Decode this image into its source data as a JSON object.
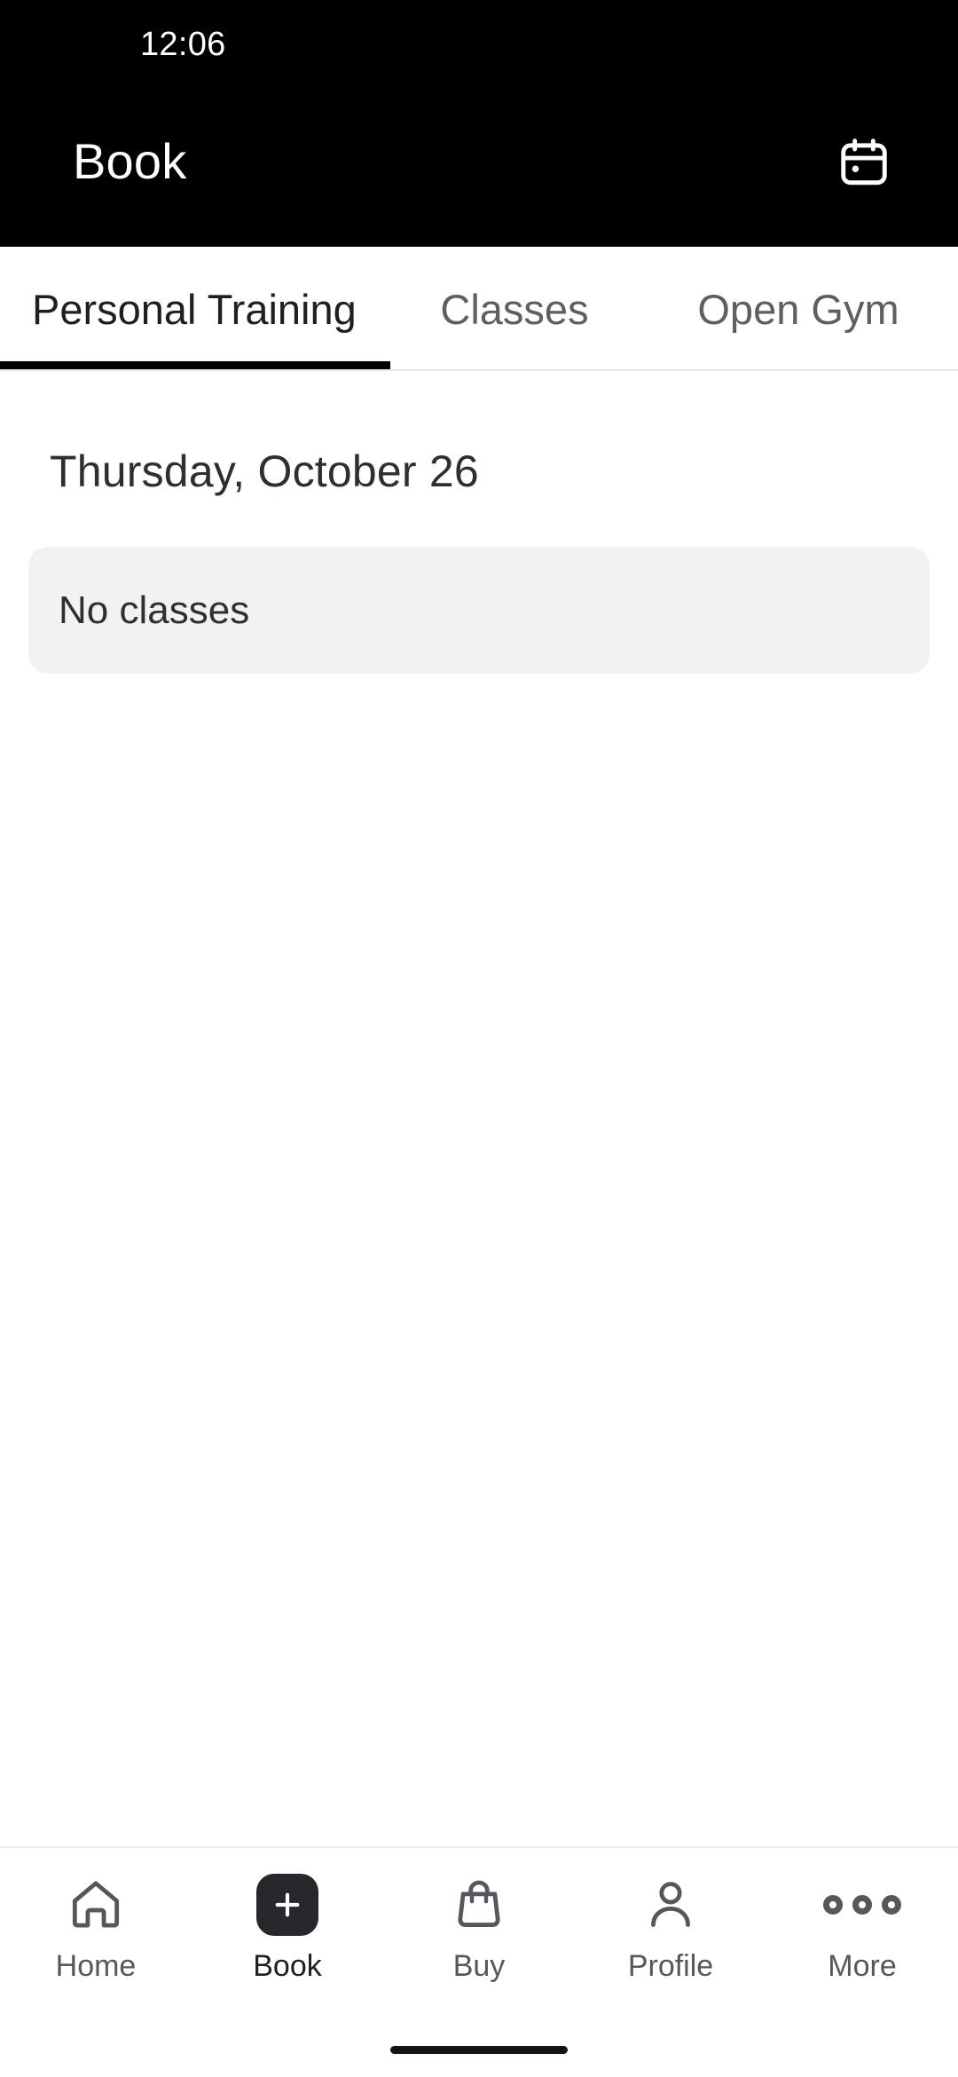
{
  "status_bar": {
    "time": "12:06"
  },
  "app_bar": {
    "title": "Book",
    "calendar_icon": "calendar-icon"
  },
  "tabs": [
    {
      "label": "Personal Training",
      "active": true
    },
    {
      "label": "Classes",
      "active": false
    },
    {
      "label": "Open Gym",
      "active": false
    }
  ],
  "content": {
    "date_heading": "Thursday, October 26",
    "empty_state": "No classes"
  },
  "bottom_nav": [
    {
      "label": "Home",
      "icon": "home-icon",
      "active": false
    },
    {
      "label": "Book",
      "icon": "plus-icon",
      "active": true
    },
    {
      "label": "Buy",
      "icon": "shopping-bag-icon",
      "active": false
    },
    {
      "label": "Profile",
      "icon": "person-icon",
      "active": false
    },
    {
      "label": "More",
      "icon": "ellipsis-icon",
      "active": false
    }
  ],
  "colors": {
    "header_background": "#000000",
    "active_tab_indicator": "#000000",
    "inactive_tab_text": "#5c6064",
    "card_background": "#f2f2f3",
    "nav_icon": "#54585d",
    "book_chip": "#26282b"
  }
}
